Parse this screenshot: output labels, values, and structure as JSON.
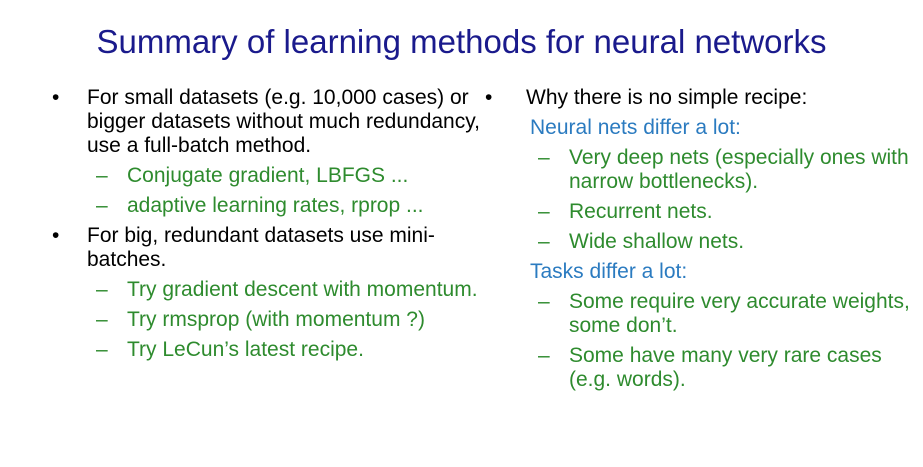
{
  "title": "Summary of learning methods for neural networks",
  "left": {
    "bullets": [
      {
        "text": "For small datasets (e.g. 10,000 cases) or bigger datasets without much redundancy, use a full-batch method.",
        "subs": [
          "Conjugate gradient, LBFGS ...",
          "adaptive learning rates, rprop ..."
        ]
      },
      {
        "text": "For big, redundant datasets use mini-batches.",
        "subs": [
          "Try gradient descent with momentum.",
          "Try rmsprop (with momentum ?)",
          "Try LeCun’s latest recipe."
        ]
      }
    ]
  },
  "right": {
    "bullet": "Why there is no simple recipe:",
    "groups": [
      {
        "heading": "Neural nets differ a lot:",
        "subs": [
          "Very deep nets (especially ones with narrow bottlenecks).",
          "Recurrent nets.",
          "Wide shallow nets."
        ]
      },
      {
        "heading": "Tasks differ a lot:",
        "subs": [
          "Some require very accurate weights, some don’t.",
          "Some have many very rare cases (e.g. words)."
        ]
      }
    ]
  },
  "glyphs": {
    "bullet": "•",
    "dash": "–"
  },
  "colors": {
    "title": "#1a1a8c",
    "body": "#000000",
    "sub": "#2e8b2e",
    "heading": "#2b7bc0"
  }
}
